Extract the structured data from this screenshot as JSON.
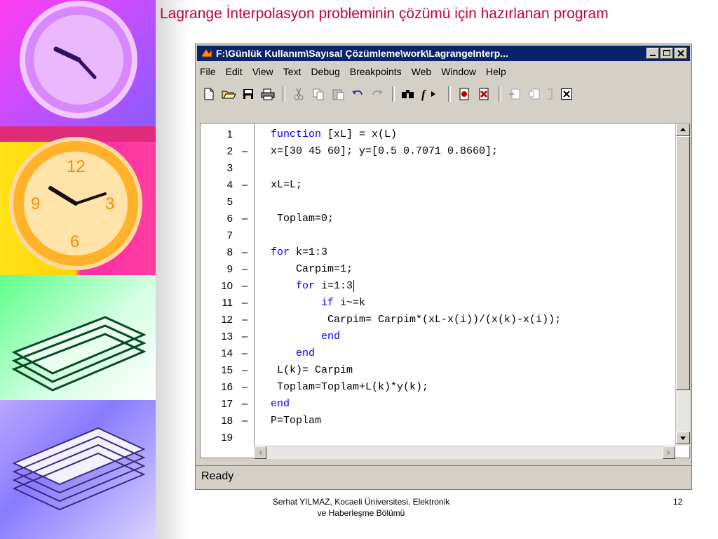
{
  "slide": {
    "title": "Lagrange İnterpolasyon probleminin çözümü  için hazırlanan program",
    "footer_line1": "Serhat YILMAZ, Kocaeli Üniversitesi, Elektronik",
    "footer_line2": "ve Haberleşme Bölümü",
    "page_number": "12"
  },
  "window": {
    "title": "F:\\Günlük Kullanım\\Sayısal Çözümleme\\work\\LagrangeInterp...",
    "menu": [
      "File",
      "Edit",
      "View",
      "Text",
      "Debug",
      "Breakpoints",
      "Web",
      "Window",
      "Help"
    ],
    "toolbar_icons": [
      "new-file-icon",
      "open-folder-icon",
      "save-icon",
      "print-icon",
      "cut-icon",
      "copy-icon",
      "paste-icon",
      "undo-icon",
      "redo-icon",
      "find-icon",
      "function-icon",
      "set-breakpoint-icon",
      "clear-breakpoint-icon",
      "step-icon",
      "step-in-icon",
      "step-out-icon"
    ],
    "status": "Ready"
  },
  "editor": {
    "lines": [
      {
        "n": "1",
        "bp": "",
        "code": "function [xL] = x(L)"
      },
      {
        "n": "2",
        "bp": "–",
        "code": "x=[30 45 60]; y=[0.5 0.7071 0.8660];"
      },
      {
        "n": "3",
        "bp": "",
        "code": ""
      },
      {
        "n": "4",
        "bp": "–",
        "code": "xL=L;"
      },
      {
        "n": "5",
        "bp": "",
        "code": ""
      },
      {
        "n": "6",
        "bp": "–",
        "code": " Toplam=0;"
      },
      {
        "n": "7",
        "bp": "",
        "code": ""
      },
      {
        "n": "8",
        "bp": "–",
        "code": "for k=1:3"
      },
      {
        "n": "9",
        "bp": "–",
        "code": "    Carpim=1;"
      },
      {
        "n": "10",
        "bp": "–",
        "code": "    for i=1:3"
      },
      {
        "n": "11",
        "bp": "–",
        "code": "        if i~=k"
      },
      {
        "n": "12",
        "bp": "–",
        "code": "         Carpim= Carpim*(xL-x(i))/(x(k)-x(i));"
      },
      {
        "n": "13",
        "bp": "–",
        "code": "        end"
      },
      {
        "n": "14",
        "bp": "–",
        "code": "    end"
      },
      {
        "n": "15",
        "bp": "–",
        "code": " L(k)= Carpim"
      },
      {
        "n": "16",
        "bp": "–",
        "code": " Toplam=Toplam+L(k)*y(k);"
      },
      {
        "n": "17",
        "bp": "–",
        "code": "end"
      },
      {
        "n": "18",
        "bp": "–",
        "code": "P=Toplam"
      },
      {
        "n": "19",
        "bp": "",
        "code": ""
      }
    ]
  },
  "colors": {
    "title": "#c0004a",
    "keyword": "#0000ff",
    "titlebar": "#0a246a"
  }
}
